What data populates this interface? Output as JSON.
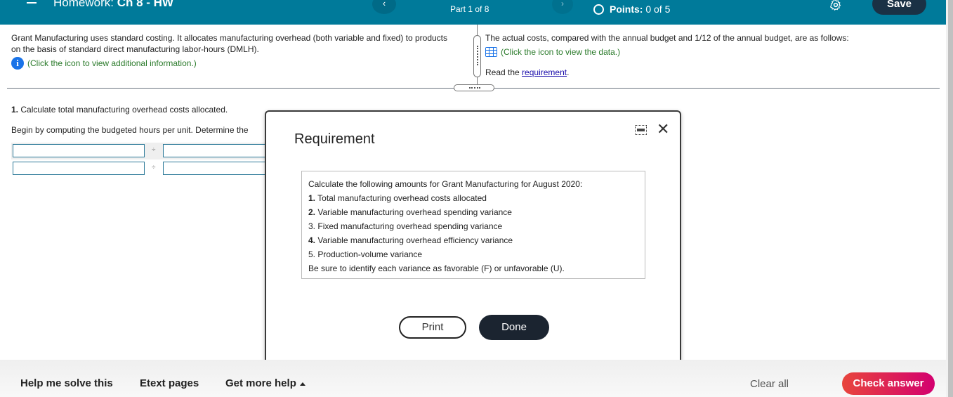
{
  "header": {
    "menu_icon": "hamburger-menu-icon",
    "title_prefix": "Homework:",
    "title": "Ch 8 - HW",
    "prev_glyph": "‹",
    "next_glyph": "›",
    "part_label": "Part 1 of 8",
    "points_label": "Points:",
    "points_value": "0 of 5",
    "settings_icon": "gear-icon",
    "save_label": "Save"
  },
  "left_pane": {
    "text": "Grant Manufacturing uses standard costing. It allocates manufacturing overhead (both variable and fixed) to products on the basis of standard direct manufacturing labor-hours (DMLH).",
    "info_icon_glyph": "i",
    "info_link": "(Click the icon to view additional information.)"
  },
  "right_pane": {
    "text": "The actual costs, compared with the annual budget and 1/12 of the annual budget, are as follows:",
    "data_link": "(Click the icon to view the data.)",
    "read_prefix": "Read the ",
    "requirement_link": "requirement",
    "read_suffix": "."
  },
  "question": {
    "number": "1.",
    "title": "Calculate total manufacturing overhead costs allocated.",
    "instruction": "Begin by computing the budgeted hours per unit. Determine the",
    "divide_sign": "÷",
    "rows": [
      {
        "numerator": "",
        "denominator": ""
      },
      {
        "numerator": "",
        "denominator": ""
      }
    ]
  },
  "modal": {
    "title": "Requirement",
    "close_glyph": "✕",
    "intro": "Calculate the following amounts for Grant Manufacturing for August 2020:",
    "items": [
      {
        "num": "1.",
        "text": "Total manufacturing overhead costs allocated"
      },
      {
        "num": "2.",
        "text": "Variable manufacturing overhead spending variance"
      },
      {
        "num": "3.",
        "text": "Fixed manufacturing overhead spending variance"
      },
      {
        "num": "4.",
        "text": "Variable manufacturing overhead efficiency variance"
      },
      {
        "num": "5.",
        "text": "Production-volume variance"
      }
    ],
    "footer_note": "Be sure to identify each variance as favorable (F) or unfavorable (U).",
    "print_label": "Print",
    "done_label": "Done"
  },
  "footer": {
    "help_label": "Help me solve this",
    "etext_label": "Etext pages",
    "more_help_label": "Get more help",
    "clear_label": "Clear all",
    "check_label": "Check answer"
  },
  "colors": {
    "header_bg": "#007a9a",
    "save_bg": "#1a3145",
    "done_bg": "#1b2430",
    "check_gradient_start": "#e8453c",
    "check_gradient_end": "#d3006f",
    "link_green": "#2a7a2a",
    "link_blue": "#1a0dab"
  }
}
